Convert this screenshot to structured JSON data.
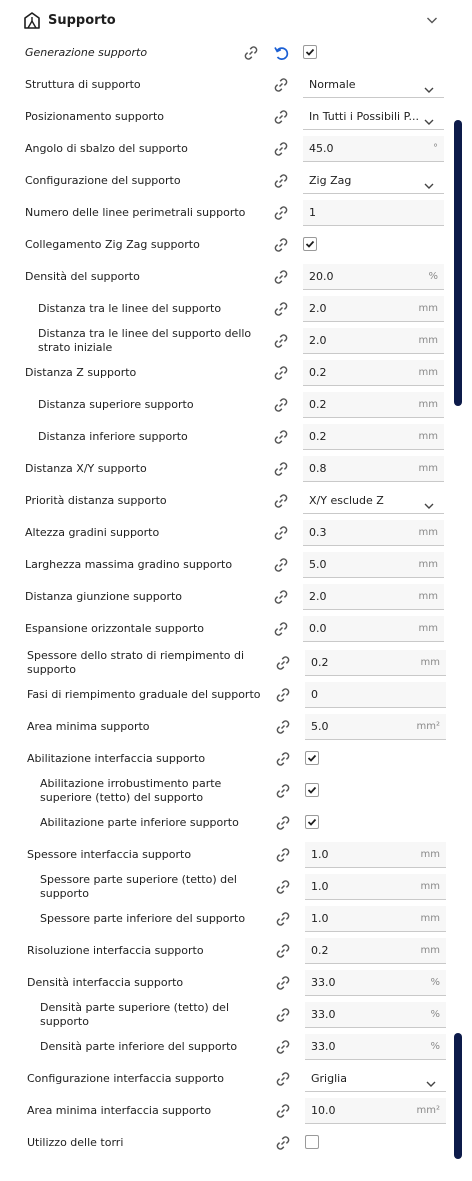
{
  "header": {
    "title": "Supporto",
    "icon": "support-icon",
    "collapse_icon": "chevron-down-icon"
  },
  "rows": [
    {
      "label": "Generazione supporto",
      "italic": true,
      "type": "checkbox",
      "checked": true,
      "reset": true
    },
    {
      "label": "Struttura di supporto",
      "type": "dropdown",
      "value": "Normale"
    },
    {
      "label": "Posizionamento supporto",
      "type": "dropdown",
      "value": "In Tutti i Possibili P..."
    },
    {
      "label": "Angolo di sbalzo del supporto",
      "type": "field",
      "value": "45.0",
      "unit": "°"
    },
    {
      "label": "Configurazione del supporto",
      "type": "dropdown",
      "value": "Zig Zag"
    },
    {
      "label": "Numero delle linee perimetrali supporto",
      "type": "field",
      "value": "1",
      "unit": ""
    },
    {
      "label": "Collegamento Zig Zag supporto",
      "type": "checkbox",
      "checked": true
    },
    {
      "label": "Densità del supporto",
      "type": "field",
      "value": "20.0",
      "unit": "%"
    },
    {
      "label": "Distanza tra le linee del supporto",
      "indent": 1,
      "type": "field",
      "value": "2.0",
      "unit": "mm"
    },
    {
      "label": "Distanza tra le linee del supporto dello strato iniziale",
      "indent": 1,
      "type": "field",
      "value": "2.0",
      "unit": "mm"
    },
    {
      "label": "Distanza Z supporto",
      "type": "field",
      "value": "0.2",
      "unit": "mm"
    },
    {
      "label": "Distanza superiore supporto",
      "indent": 1,
      "type": "field",
      "value": "0.2",
      "unit": "mm"
    },
    {
      "label": "Distanza inferiore supporto",
      "indent": 1,
      "type": "field",
      "value": "0.2",
      "unit": "mm"
    },
    {
      "label": "Distanza X/Y supporto",
      "type": "field",
      "value": "0.8",
      "unit": "mm"
    },
    {
      "label": "Priorità distanza supporto",
      "type": "dropdown",
      "value": "X/Y esclude Z"
    },
    {
      "label": "Altezza gradini supporto",
      "type": "field",
      "value": "0.3",
      "unit": "mm"
    },
    {
      "label": "Larghezza massima gradino supporto",
      "type": "field",
      "value": "5.0",
      "unit": "mm"
    },
    {
      "label": "Distanza giunzione supporto",
      "type": "field",
      "value": "2.0",
      "unit": "mm"
    },
    {
      "label": "Espansione orizzontale supporto",
      "type": "field",
      "value": "0.0",
      "unit": "mm"
    },
    {
      "label": "Spessore dello strato di riempimento di supporto",
      "shift": 1,
      "type": "field",
      "value": "0.2",
      "unit": "mm"
    },
    {
      "label": "Fasi di riempimento graduale del supporto",
      "shift": 1,
      "type": "field",
      "value": "0",
      "unit": ""
    },
    {
      "label": "Area minima supporto",
      "shift": 1,
      "type": "field",
      "value": "5.0",
      "unit": "mm²"
    },
    {
      "label": "Abilitazione interfaccia supporto",
      "shift": 1,
      "type": "checkbox",
      "checked": true
    },
    {
      "label": "Abilitazione irrobustimento parte superiore (tetto) del supporto",
      "shift": 1,
      "indent": 1,
      "type": "checkbox",
      "checked": true
    },
    {
      "label": "Abilitazione parte inferiore supporto",
      "shift": 1,
      "indent": 1,
      "type": "checkbox",
      "checked": true
    },
    {
      "label": "Spessore interfaccia supporto",
      "shift": 1,
      "type": "field",
      "value": "1.0",
      "unit": "mm"
    },
    {
      "label": "Spessore parte superiore (tetto) del supporto",
      "shift": 1,
      "indent": 1,
      "type": "field",
      "value": "1.0",
      "unit": "mm"
    },
    {
      "label": "Spessore parte inferiore del supporto",
      "shift": 1,
      "indent": 1,
      "type": "field",
      "value": "1.0",
      "unit": "mm"
    },
    {
      "label": "Risoluzione interfaccia supporto",
      "shift": 1,
      "type": "field",
      "value": "0.2",
      "unit": "mm"
    },
    {
      "label": "Densità interfaccia supporto",
      "shift": 1,
      "type": "field",
      "value": "33.0",
      "unit": "%"
    },
    {
      "label": "Densità parte superiore (tetto) del supporto",
      "shift": 1,
      "indent": 1,
      "type": "field",
      "value": "33.0",
      "unit": "%"
    },
    {
      "label": "Densità parte inferiore del supporto",
      "shift": 1,
      "indent": 1,
      "type": "field",
      "value": "33.0",
      "unit": "%"
    },
    {
      "label": "Configurazione interfaccia supporto",
      "shift": 1,
      "type": "dropdown",
      "value": "Griglia"
    },
    {
      "label": "Area minima interfaccia supporto",
      "shift": 1,
      "type": "field",
      "value": "10.0",
      "unit": "mm²"
    },
    {
      "label": "Utilizzo delle torri",
      "shift": 1,
      "type": "checkbox",
      "checked": false
    }
  ],
  "colors": {
    "accent": "#1a5fd4",
    "scrollbar": "#0d1b4a",
    "field_bg": "#f7f7f7"
  }
}
